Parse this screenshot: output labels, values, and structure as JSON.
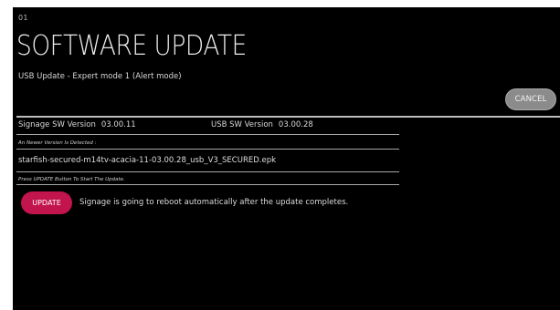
{
  "header": {
    "page_number": "01",
    "title": "SOFTWARE UPDATE",
    "subtitle": "USB Update - Expert mode 1 (Alert mode)"
  },
  "actions": {
    "cancel_label": "CANCEL",
    "update_label": "UPDATE"
  },
  "versions": {
    "signage_label": "Signage SW Version",
    "signage_value": "03.00.11",
    "usb_label": "USB SW Version",
    "usb_value": "03.00.28"
  },
  "detection": {
    "note": "An Newer Version Is Detected :",
    "file_name": "starfish-secured-m14tv-acacia-11-03.00.28_usb_V3_SECURED.epk"
  },
  "instruction": {
    "note": "Press UPDATE Button To Start The Update.",
    "reboot_message": "Signage is going to reboot automatically after the update completes."
  },
  "colors": {
    "background": "#000000",
    "update_button": "#c2144d",
    "cancel_button": "#8b8b8b",
    "text": "#e8e8e8"
  }
}
